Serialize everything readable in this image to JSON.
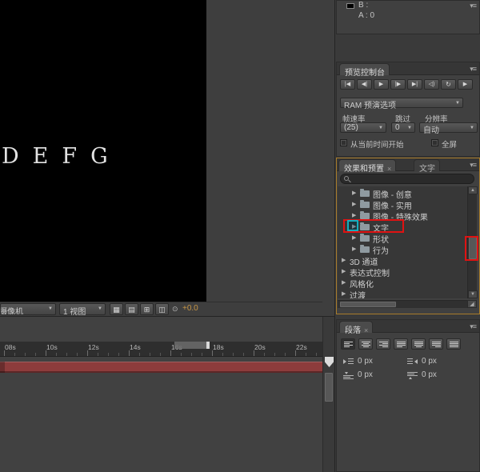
{
  "colors": {
    "annotation_red": "#e01212",
    "annotation_cyan": "#14aebe",
    "focus_orange": "#a87c2a",
    "red_bar": "#8d3c3c",
    "exposure_orange": "#c79544"
  },
  "icons": {
    "panel_menu": "▾≡",
    "close": "×",
    "tree_arrow": "▶",
    "dropdown_arrow": "▼",
    "scroll_up": "▲",
    "scroll_down": "▼",
    "corner_grip": "◢",
    "toolbar_icons": [
      "▦",
      "▤",
      "⊞",
      "◫"
    ],
    "exposure": "⊙"
  },
  "viewer": {
    "text": "DEFG"
  },
  "comp_toolbar": {
    "camera": "活动摄像机",
    "view": "1 视图",
    "exposure": "+0.0"
  },
  "timeline": {
    "ticks": [
      "08s",
      "10s",
      "12s",
      "14s",
      "16s",
      "18s",
      "20s",
      "22s"
    ]
  },
  "info_panel": {
    "b_label": "B :",
    "a_label": "A : 0"
  },
  "preview_panel": {
    "tab": "预览控制台",
    "transport_buttons": [
      "|◀",
      "◀|",
      "▶",
      "|▶",
      "▶|",
      "◁)",
      "↻",
      "▶"
    ],
    "ram_options": "RAM 预演选项",
    "framerate_label": "帧速率",
    "skip_label": "跳过",
    "resolution_label": "分辨率",
    "framerate_value": "(25)",
    "skip_value": "0",
    "resolution_value": "自动",
    "from_current_label": "从当前时间开始",
    "fullscreen_label": "全屏"
  },
  "effects_panel": {
    "tab": "效果和预置",
    "tab2": "文字",
    "tree": [
      {
        "label": "图像 - 创意"
      },
      {
        "label": "图像 - 实用"
      },
      {
        "label": "图像 - 特殊效果"
      },
      {
        "label": "文字"
      },
      {
        "label": "形状"
      },
      {
        "label": "行为"
      },
      {
        "label": "3D 通道"
      },
      {
        "label": "表达式控制"
      },
      {
        "label": "风格化"
      },
      {
        "label": "过渡"
      }
    ]
  },
  "paragraph_panel": {
    "tab": "段落",
    "fields": [
      {
        "value": "0 px"
      },
      {
        "value": "0 px"
      },
      {
        "value": "0 px"
      },
      {
        "value": "0 px"
      }
    ]
  }
}
